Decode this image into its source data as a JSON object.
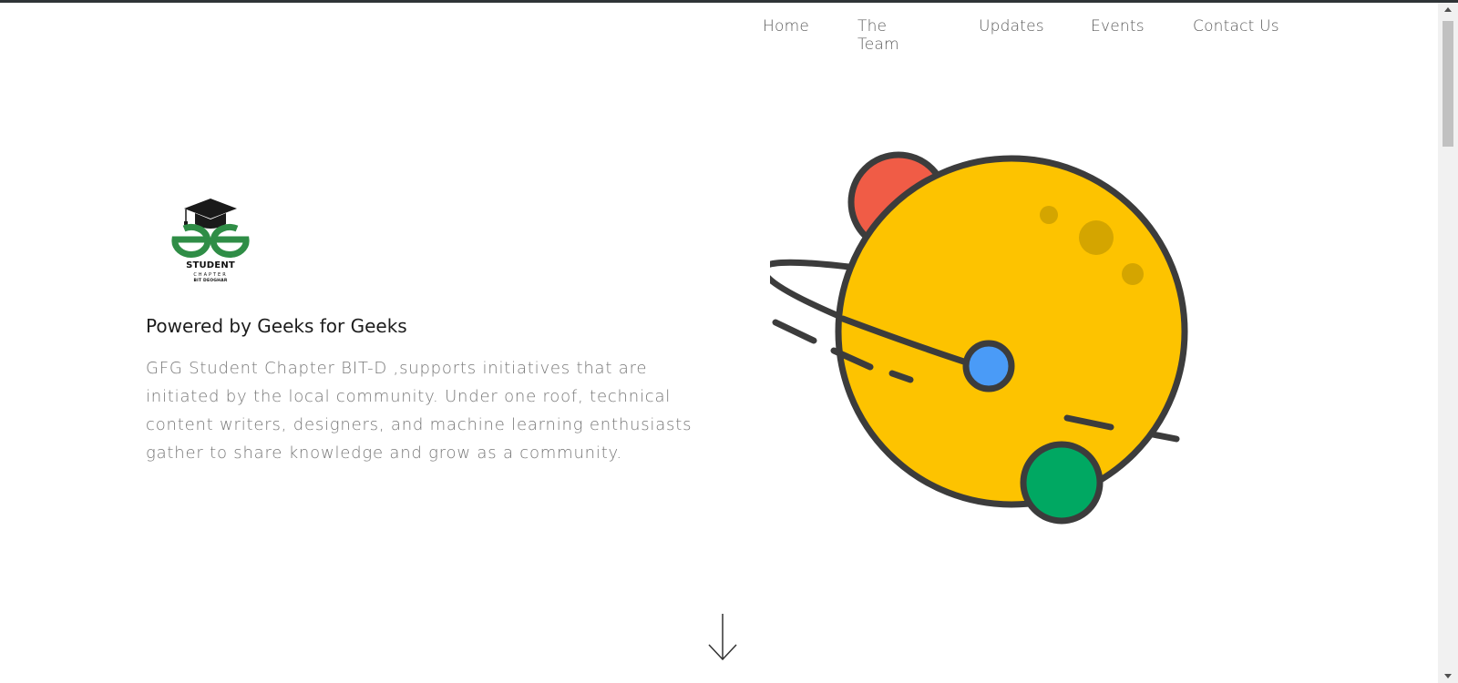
{
  "nav": {
    "items": [
      {
        "label": "Home"
      },
      {
        "label": "The Team"
      },
      {
        "label": "Updates"
      },
      {
        "label": "Events"
      },
      {
        "label": "Contact Us"
      }
    ]
  },
  "logo": {
    "student": "STUDENT",
    "chapter": "CHAPTER",
    "bit": "BIT DEOGHAR",
    "icon": "gfg-graduation-cap-logo"
  },
  "hero": {
    "title": "Powered by Geeks for Geeks",
    "description": "GFG Student Chapter BIT-D ,supports initiatives that are initiated by the local community. Under one roof, technical content writers, designers, and machine learning enthusiasts gather to share knowledge and grow as a community."
  },
  "icons": {
    "scroll_down": "arrow-down-icon",
    "illustration": "planet-illustration"
  },
  "colors": {
    "planet": "#FDC300",
    "red_moon": "#F05C46",
    "blue_moon": "#4A9BF7",
    "green_moon": "#00A862",
    "outline": "#3C3C3C",
    "logo_green": "#2F8D46"
  }
}
